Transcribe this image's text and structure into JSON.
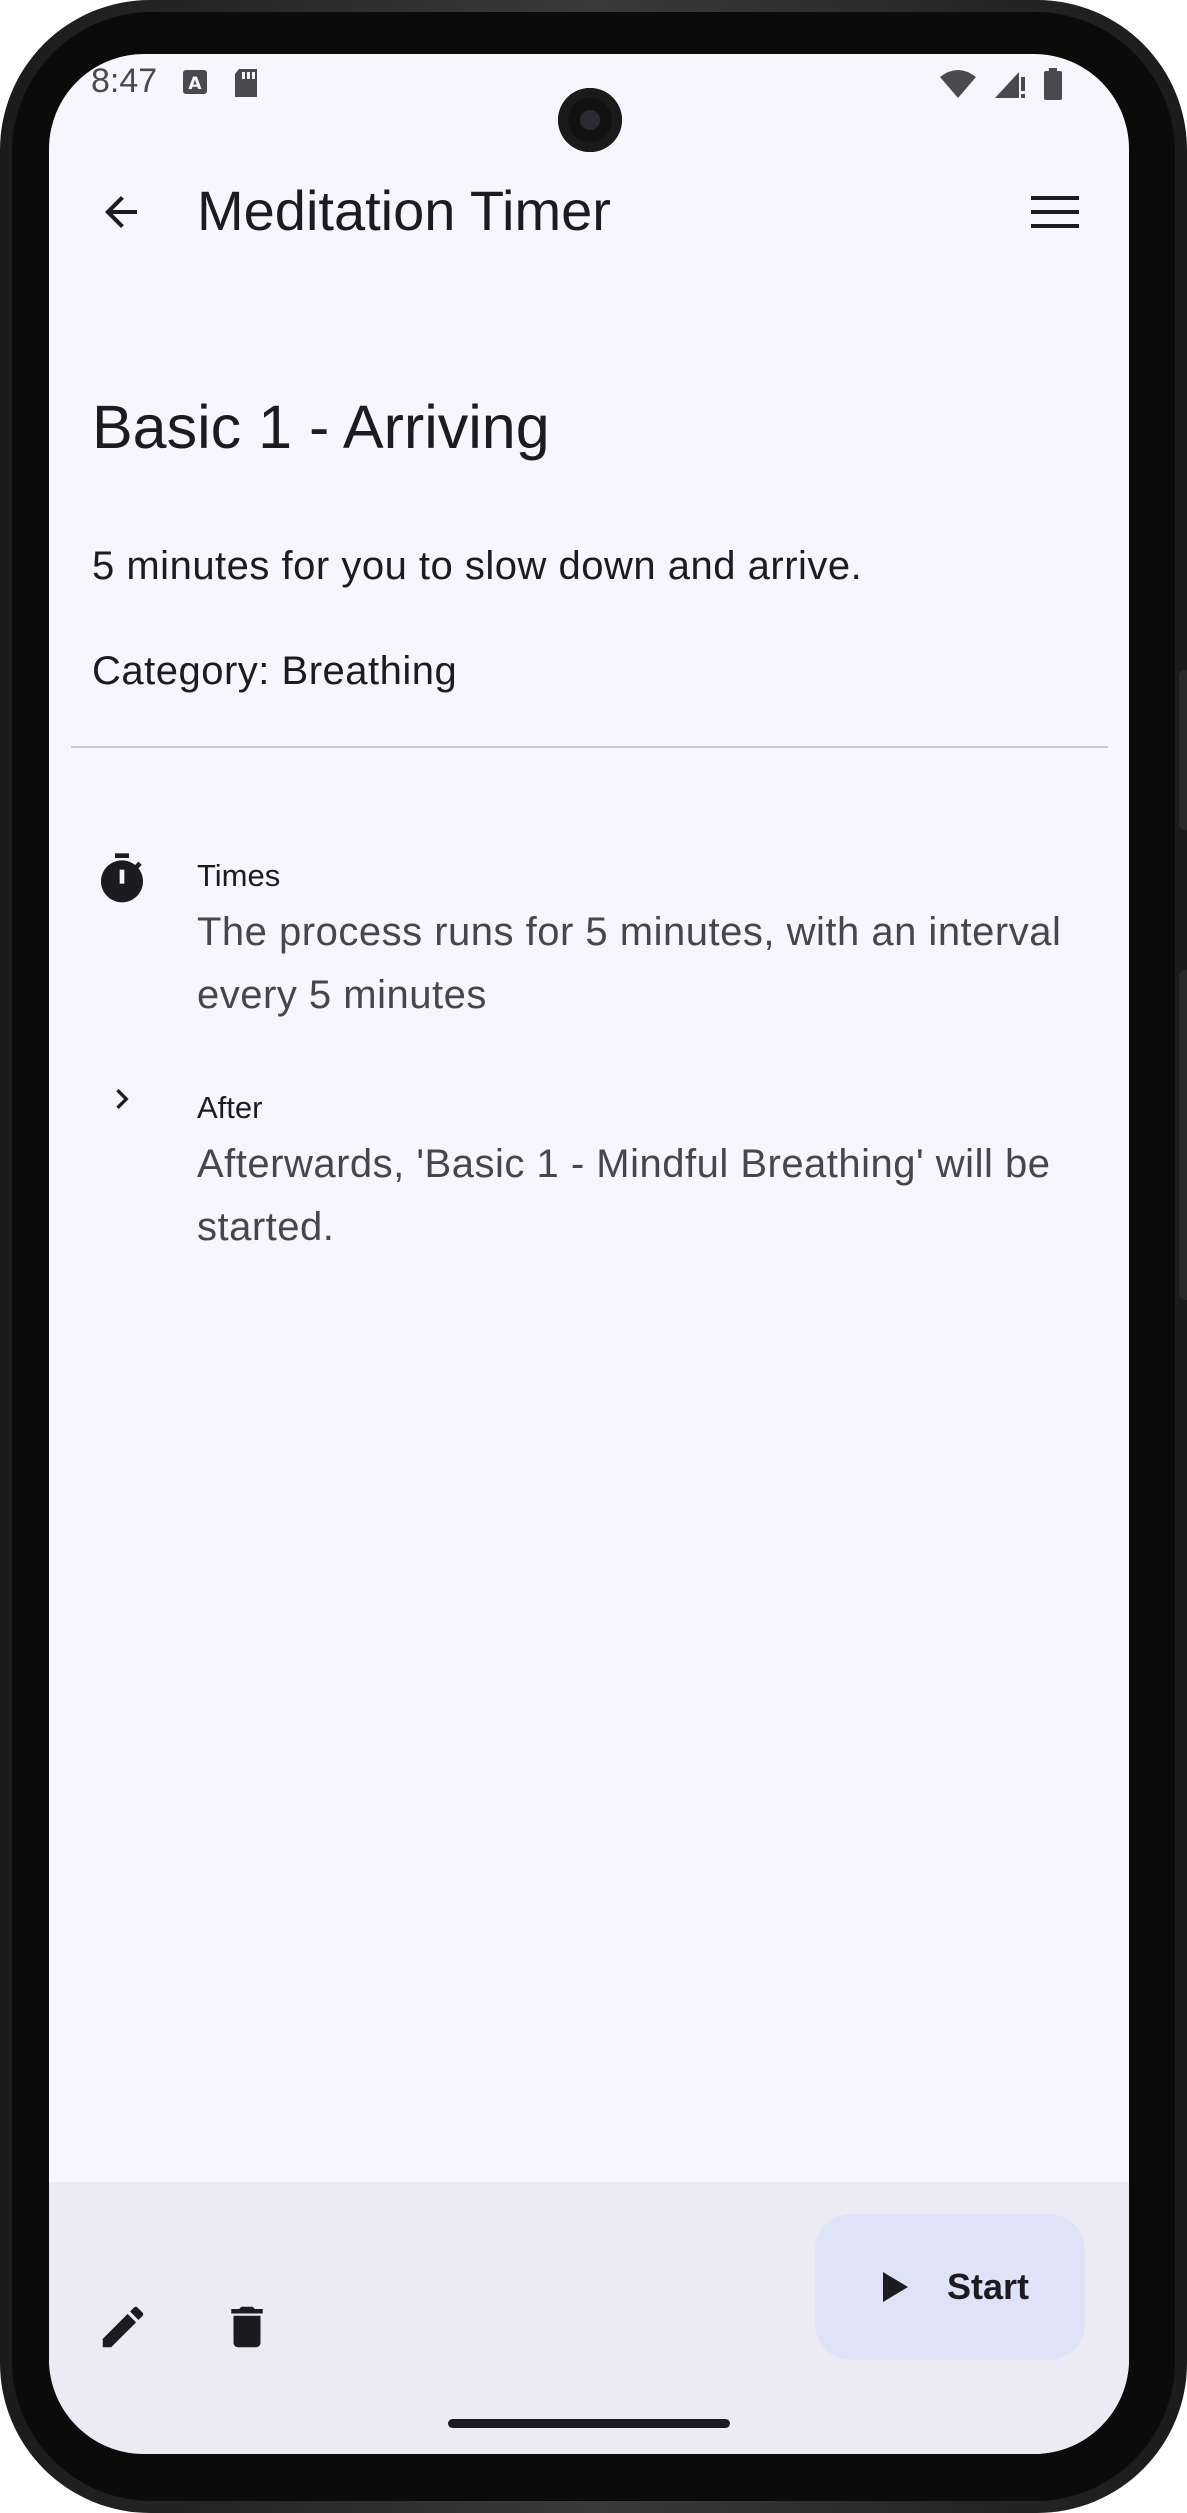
{
  "status_bar": {
    "time": "8:47"
  },
  "app_bar": {
    "title": "Meditation Timer"
  },
  "timer": {
    "name": "Basic 1 - Arriving",
    "description": "5 minutes for you to slow down and arrive.",
    "category": "Category: Breathing"
  },
  "info": [
    {
      "label": "Times",
      "value": "The process runs for 5 minutes, with an interval every 5 minutes",
      "icon": "stopwatch-icon"
    },
    {
      "label": "After",
      "value": "Afterwards, 'Basic 1 - Mindful Breathing' will be started.",
      "icon": "chevron-right-icon"
    }
  ],
  "bottom_bar": {
    "start_label": "Start",
    "edit_icon": "pencil-icon",
    "delete_icon": "trash-icon"
  },
  "colors": {
    "background": "#f7f6fc",
    "bottom_bar": "#ecebf3",
    "fab": "#dfe3f7",
    "text_primary": "#1c1b20",
    "text_secondary": "#46464f",
    "divider": "#c9c7ce"
  }
}
